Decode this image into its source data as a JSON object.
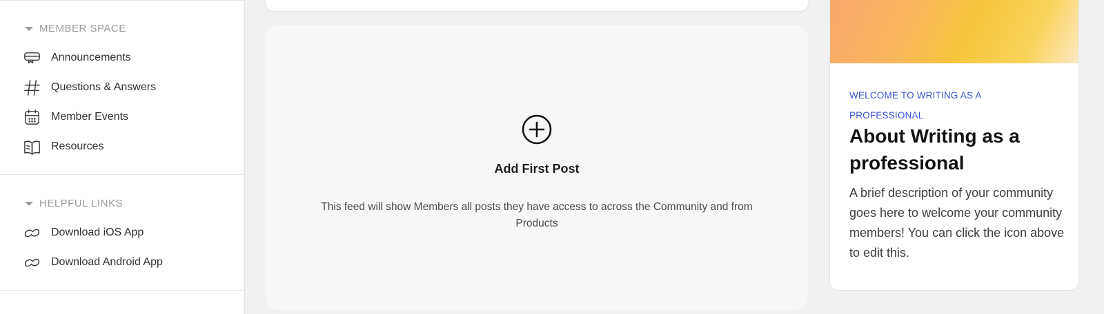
{
  "sidebar": {
    "member_space": {
      "title": "MEMBER SPACE",
      "items": [
        {
          "label": "Announcements",
          "icon": "announcement-icon"
        },
        {
          "label": "Questions & Answers",
          "icon": "hashtag-icon"
        },
        {
          "label": "Member Events",
          "icon": "calendar-icon"
        },
        {
          "label": "Resources",
          "icon": "book-icon"
        }
      ]
    },
    "helpful_links": {
      "title": "HELPFUL LINKS",
      "items": [
        {
          "label": "Download iOS App",
          "icon": "link-icon"
        },
        {
          "label": "Download Android App",
          "icon": "link-icon"
        }
      ]
    }
  },
  "feed": {
    "empty_title": "Add First Post",
    "empty_description": "This feed will show Members all posts they have access to across the Community and from Products",
    "add_icon": "plus-circle-icon"
  },
  "about": {
    "eyebrow": "WELCOME TO WRITING AS A PROFESSIONAL",
    "title": "About Writing as a professional",
    "description": "A brief description of your community goes here to welcome your community members! You can click the icon above to edit this."
  },
  "colors": {
    "accent": "#3553d6",
    "background": "#f1f1f1",
    "banner_gradient": [
      "#f8a96c",
      "#f8c63c",
      "#fde9c8"
    ]
  }
}
